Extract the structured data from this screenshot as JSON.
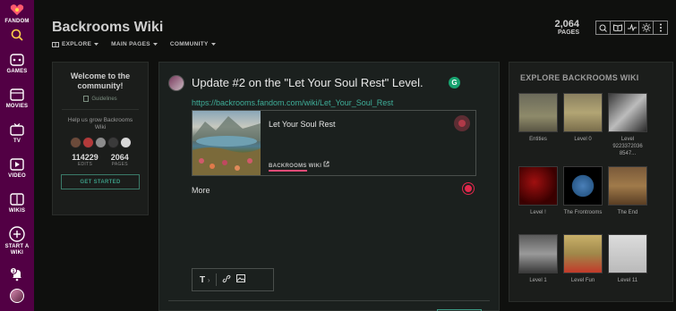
{
  "rail": {
    "items": [
      {
        "label": "FANDOM",
        "icon": "fandom-heart-icon"
      },
      {
        "label": "",
        "icon": "search-icon"
      },
      {
        "label": "GAMES",
        "icon": "games-icon"
      },
      {
        "label": "MOVIES",
        "icon": "movies-icon"
      },
      {
        "label": "TV",
        "icon": "tv-icon"
      },
      {
        "label": "VIDEO",
        "icon": "video-icon"
      },
      {
        "label": "WIKIS",
        "icon": "wikis-icon"
      },
      {
        "label": "START A WIKI",
        "icon": "plus-icon"
      }
    ],
    "notification_count": "1"
  },
  "header": {
    "wiki_title": "Backrooms Wiki",
    "nav": [
      "EXPLORE",
      "MAIN PAGES",
      "COMMUNITY"
    ],
    "pages_count": "2,064",
    "pages_label": "PAGES"
  },
  "welcome": {
    "title": "Welcome to the community!",
    "guidelines": "Guidelines",
    "grow_text": "Help us grow Backrooms Wiki",
    "edits_value": "114229",
    "edits_label": "EDITS",
    "pages_value": "2064",
    "pages_label": "PAGES",
    "cta": "GET STARTED"
  },
  "editor": {
    "post_title": "Update #2 on the \"Let Your Soul Rest\" Level.",
    "link": "https://backrooms.fandom.com/wiki/Let_Your_Soul_Rest",
    "card_title": "Let Your Soul Rest",
    "card_wiki_name": "BACKROOMS",
    "card_wiki_suffix": "WIKI",
    "more": "More",
    "grammarly_letter": "G",
    "text_tool": "T"
  },
  "explore": {
    "title": "EXPLORE BACKROOMS WIKI",
    "tiles": [
      {
        "caption": "Entities"
      },
      {
        "caption": "Level 0"
      },
      {
        "caption": "Level 9223372036 8547..."
      },
      {
        "caption": "Level !"
      },
      {
        "caption": "The Frontrooms"
      },
      {
        "caption": "The End"
      },
      {
        "caption": "Level 1"
      },
      {
        "caption": "Level Fun"
      },
      {
        "caption": "Level 11"
      }
    ]
  },
  "colors": {
    "rail": "#520044",
    "accent_teal": "#3fae99",
    "accent_pink": "#e64c77"
  }
}
